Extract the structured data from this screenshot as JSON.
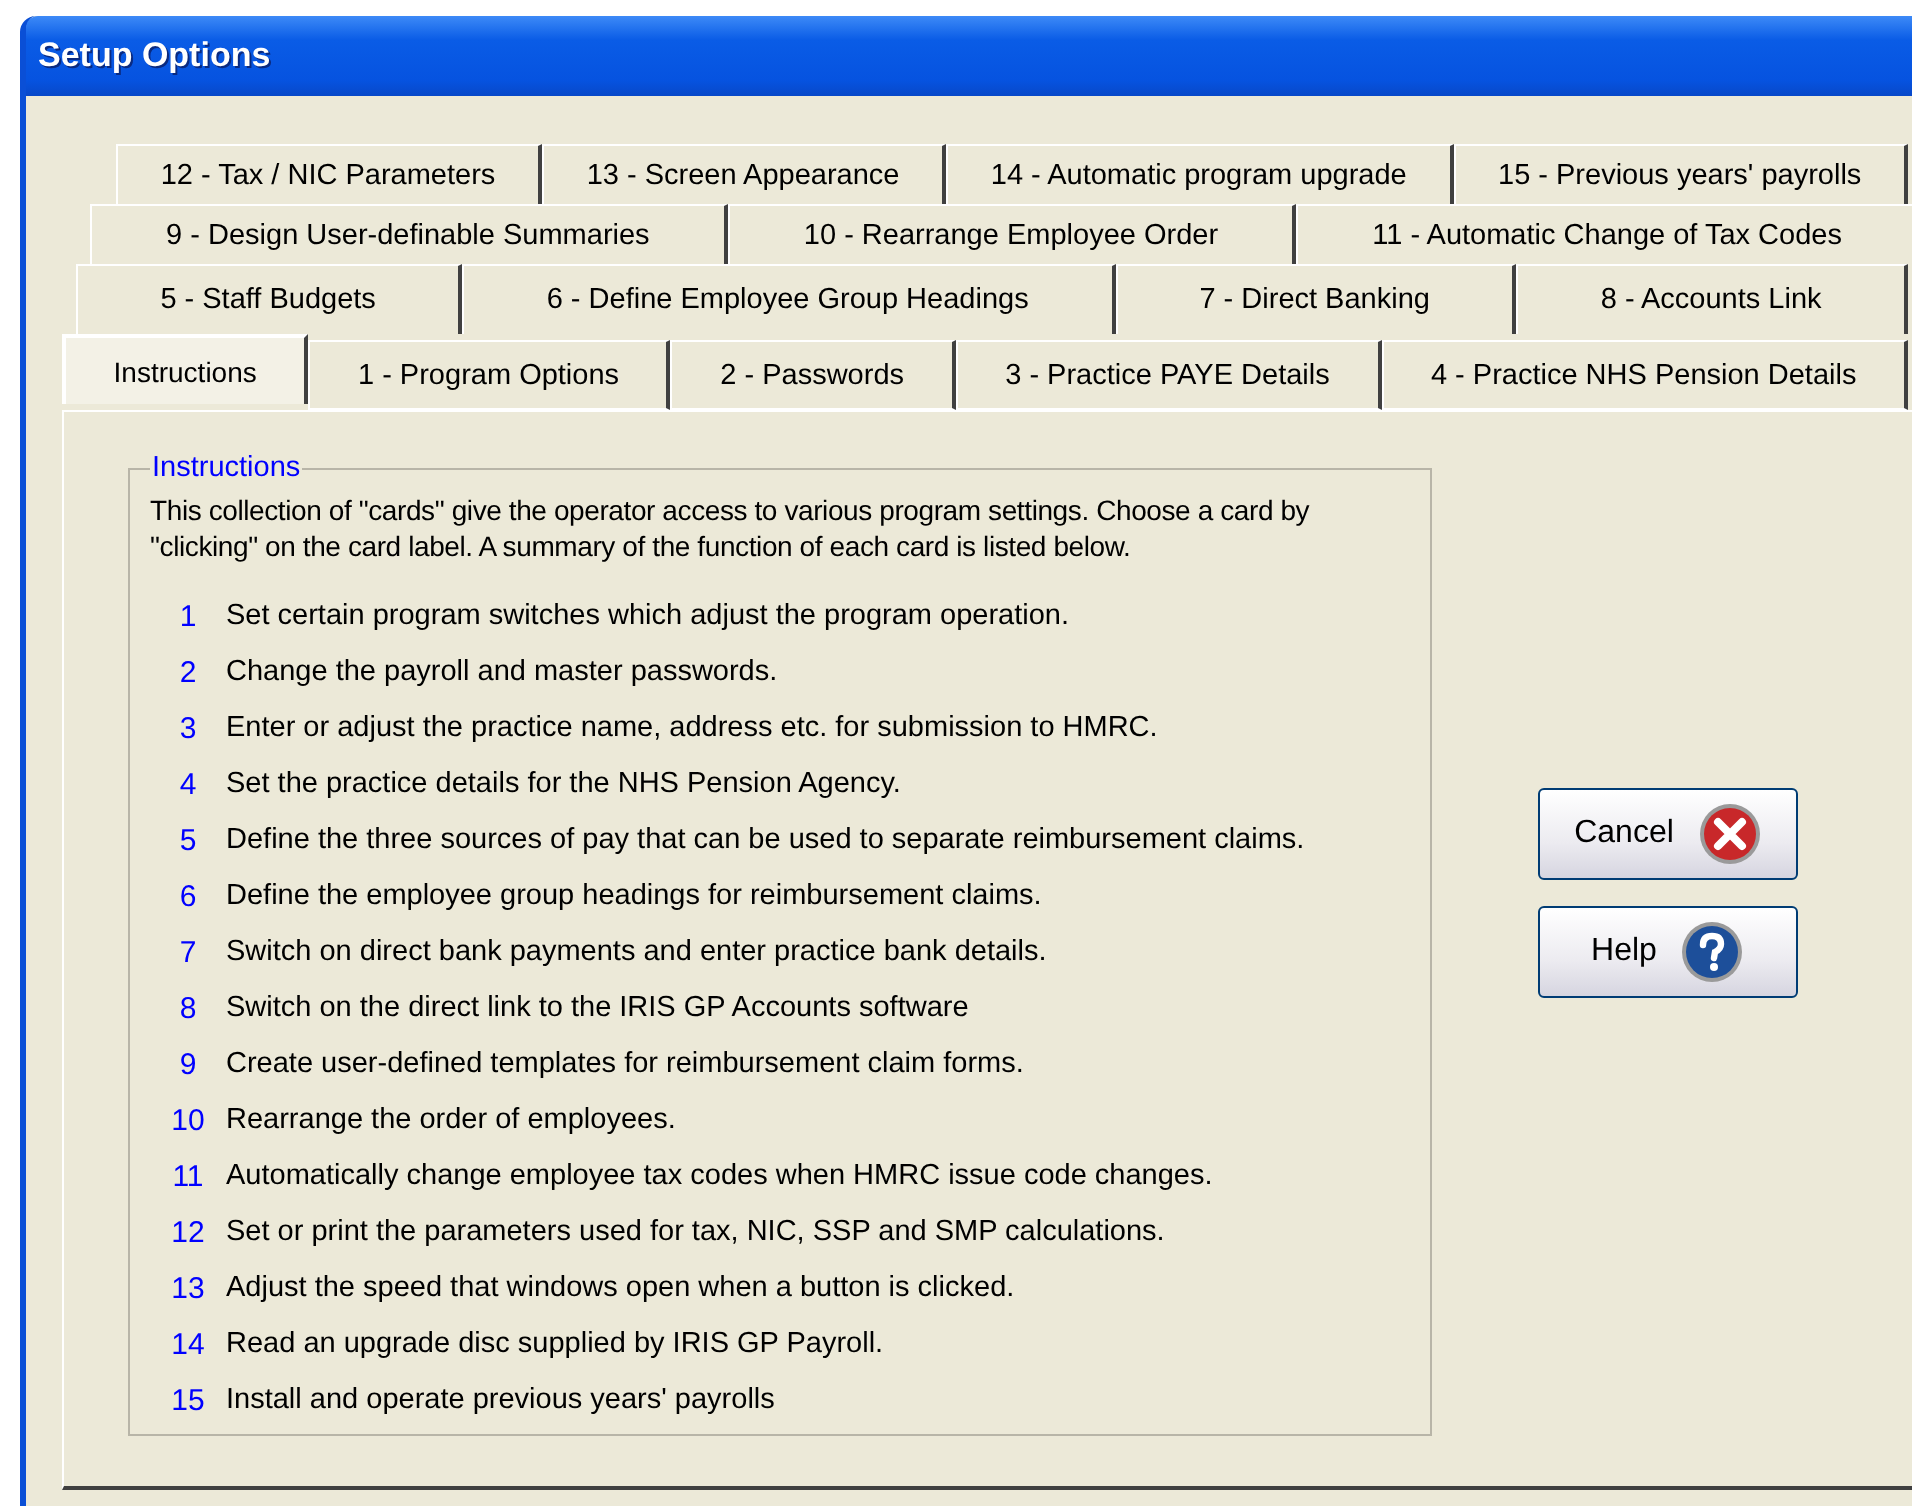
{
  "window": {
    "title": "Setup Options"
  },
  "tab_rows": [
    [
      {
        "label": "12 - Tax / NIC Parameters",
        "selected": false
      },
      {
        "label": "13 - Screen Appearance",
        "selected": false
      },
      {
        "label": "14 - Automatic program upgrade",
        "selected": false
      },
      {
        "label": "15 - Previous years' payrolls",
        "selected": false
      }
    ],
    [
      {
        "label": "9 - Design User-definable Summaries",
        "selected": false
      },
      {
        "label": "10 - Rearrange Employee Order",
        "selected": false
      },
      {
        "label": "11 - Automatic Change of Tax Codes",
        "selected": false
      }
    ],
    [
      {
        "label": "5 - Staff  Budgets",
        "selected": false
      },
      {
        "label": "6 - Define Employee Group Headings",
        "selected": false
      },
      {
        "label": "7 - Direct Banking",
        "selected": false
      },
      {
        "label": "8 - Accounts Link",
        "selected": false
      }
    ],
    [
      {
        "label": "Instructions",
        "selected": true
      },
      {
        "label": "1 - Program Options",
        "selected": false
      },
      {
        "label": "2 - Passwords",
        "selected": false
      },
      {
        "label": "3 - Practice PAYE Details",
        "selected": false
      },
      {
        "label": "4 - Practice NHS Pension Details",
        "selected": false
      }
    ]
  ],
  "instructions": {
    "title": "Instructions",
    "intro": "This collection of \"cards\" give the operator access to various program settings. Choose a card by \"clicking\" on the card label.  A summary of the function of each card is listed below.",
    "items": [
      {
        "number": "1",
        "text": "Set certain program switches which adjust the program operation."
      },
      {
        "number": "2",
        "text": "Change the payroll and master passwords."
      },
      {
        "number": "3",
        "text": "Enter or adjust the practice name, address etc. for submission to HMRC."
      },
      {
        "number": "4",
        "text": "Set the practice details for the NHS Pension Agency."
      },
      {
        "number": "5",
        "text": "Define the three sources of pay that can be used to separate reimbursement claims."
      },
      {
        "number": "6",
        "text": "Define the employee group headings for reimbursement claims."
      },
      {
        "number": "7",
        "text": "Switch on direct bank payments and enter practice bank details."
      },
      {
        "number": "8",
        "text": "Switch on the direct link to the IRIS GP Accounts software"
      },
      {
        "number": "9",
        "text": "Create user-defined templates for reimbursement claim forms."
      },
      {
        "number": "10",
        "text": "Rearrange the order of employees."
      },
      {
        "number": "11",
        "text": "Automatically change employee tax codes when HMRC issue code changes."
      },
      {
        "number": "12",
        "text": "Set or print the parameters used for tax, NIC, SSP and SMP calculations."
      },
      {
        "number": "13",
        "text": "Adjust the speed that windows open when a button is clicked."
      },
      {
        "number": "14",
        "text": "Read an upgrade disc supplied by IRIS GP Payroll."
      },
      {
        "number": "15",
        "text": "Install and operate previous years' payrolls"
      }
    ]
  },
  "buttons": [
    {
      "label": "Cancel",
      "kind": "cancel"
    },
    {
      "label": "Help",
      "kind": "help"
    }
  ]
}
